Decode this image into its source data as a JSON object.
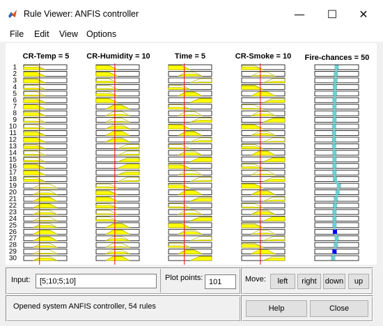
{
  "window": {
    "title": "Rule Viewer: ANFIS controller",
    "minimize_glyph": "—",
    "maximize_glyph": "☐",
    "close_glyph": "✕"
  },
  "menu": {
    "items": [
      "File",
      "Edit",
      "View",
      "Options"
    ]
  },
  "inputs": [
    {
      "name": "CR-Temp = 5",
      "value": 5,
      "range": [
        0,
        60
      ]
    },
    {
      "name": "CR-Humidity = 10",
      "value": 10,
      "range": [
        0,
        60
      ]
    },
    {
      "name": "Time = 5",
      "value": 5,
      "range": [
        0,
        60
      ]
    },
    {
      "name": "CR-Smoke = 10",
      "value": 10,
      "range": [
        0,
        60
      ]
    }
  ],
  "output": {
    "name": "Fire-chances = 50",
    "value": 50
  },
  "rule_numbers": [
    "1",
    "2",
    "3",
    "4",
    "5",
    "6",
    "7",
    "8",
    "9",
    "10",
    "11",
    "12",
    "13",
    "14",
    "15",
    "16",
    "17",
    "18",
    "19",
    "20",
    "21",
    "22",
    "23",
    "24",
    "25",
    "26",
    "27",
    "28",
    "29",
    "30"
  ],
  "rule_mfs": {
    "temp": [
      0,
      0,
      0,
      0,
      0,
      0,
      0,
      0,
      0,
      0,
      0,
      0,
      0,
      0,
      0,
      0,
      0,
      0,
      1,
      1,
      1,
      1,
      1,
      1,
      1,
      1,
      1,
      1,
      1,
      1
    ],
    "humidity": [
      0,
      0,
      0,
      0,
      0,
      0,
      1,
      1,
      1,
      1,
      1,
      1,
      2,
      2,
      2,
      2,
      2,
      2,
      0,
      0,
      0,
      0,
      0,
      0,
      1,
      1,
      1,
      1,
      1,
      1
    ],
    "time": [
      0,
      1,
      2,
      0,
      1,
      2,
      0,
      1,
      2,
      0,
      1,
      2,
      0,
      1,
      2,
      0,
      1,
      2,
      0,
      1,
      2,
      0,
      1,
      2,
      0,
      1,
      2,
      0,
      1,
      2
    ],
    "smoke": [
      0,
      1,
      2,
      0,
      1,
      2,
      0,
      1,
      2,
      0,
      1,
      2,
      0,
      1,
      2,
      0,
      1,
      2,
      0,
      1,
      2,
      0,
      1,
      2,
      0,
      1,
      2,
      0,
      1,
      2
    ]
  },
  "output_points": [
    0.5,
    0.48,
    0.47,
    0.46,
    0.46,
    0.45,
    0.45,
    0.45,
    0.45,
    0.44,
    0.44,
    0.44,
    0.44,
    0.45,
    0.45,
    0.45,
    0.45,
    0.46,
    0.55,
    0.52,
    0.48,
    0.46,
    0.45,
    0.45,
    0.45,
    0.46,
    0.5,
    0.48,
    0.45,
    0.42
  ],
  "output_highlight_rows": [
    26,
    29
  ],
  "colors": {
    "mf_fill": "#ffff00",
    "mf_line": "#b0b000",
    "input_line": "#ff0000",
    "output_marker": "#6ecfd0",
    "output_highlight": "#0000ff"
  },
  "controls": {
    "input_label": "Input:",
    "input_value": "[5;10;5;10]",
    "plot_points_label": "Plot points:",
    "plot_points_value": "101",
    "move_label": "Move:",
    "left_label": "left",
    "right_label": "right",
    "down_label": "down",
    "up_label": "up",
    "status": "Opened system ANFIS controller, 54 rules",
    "help_label": "Help",
    "close_label": "Close"
  }
}
